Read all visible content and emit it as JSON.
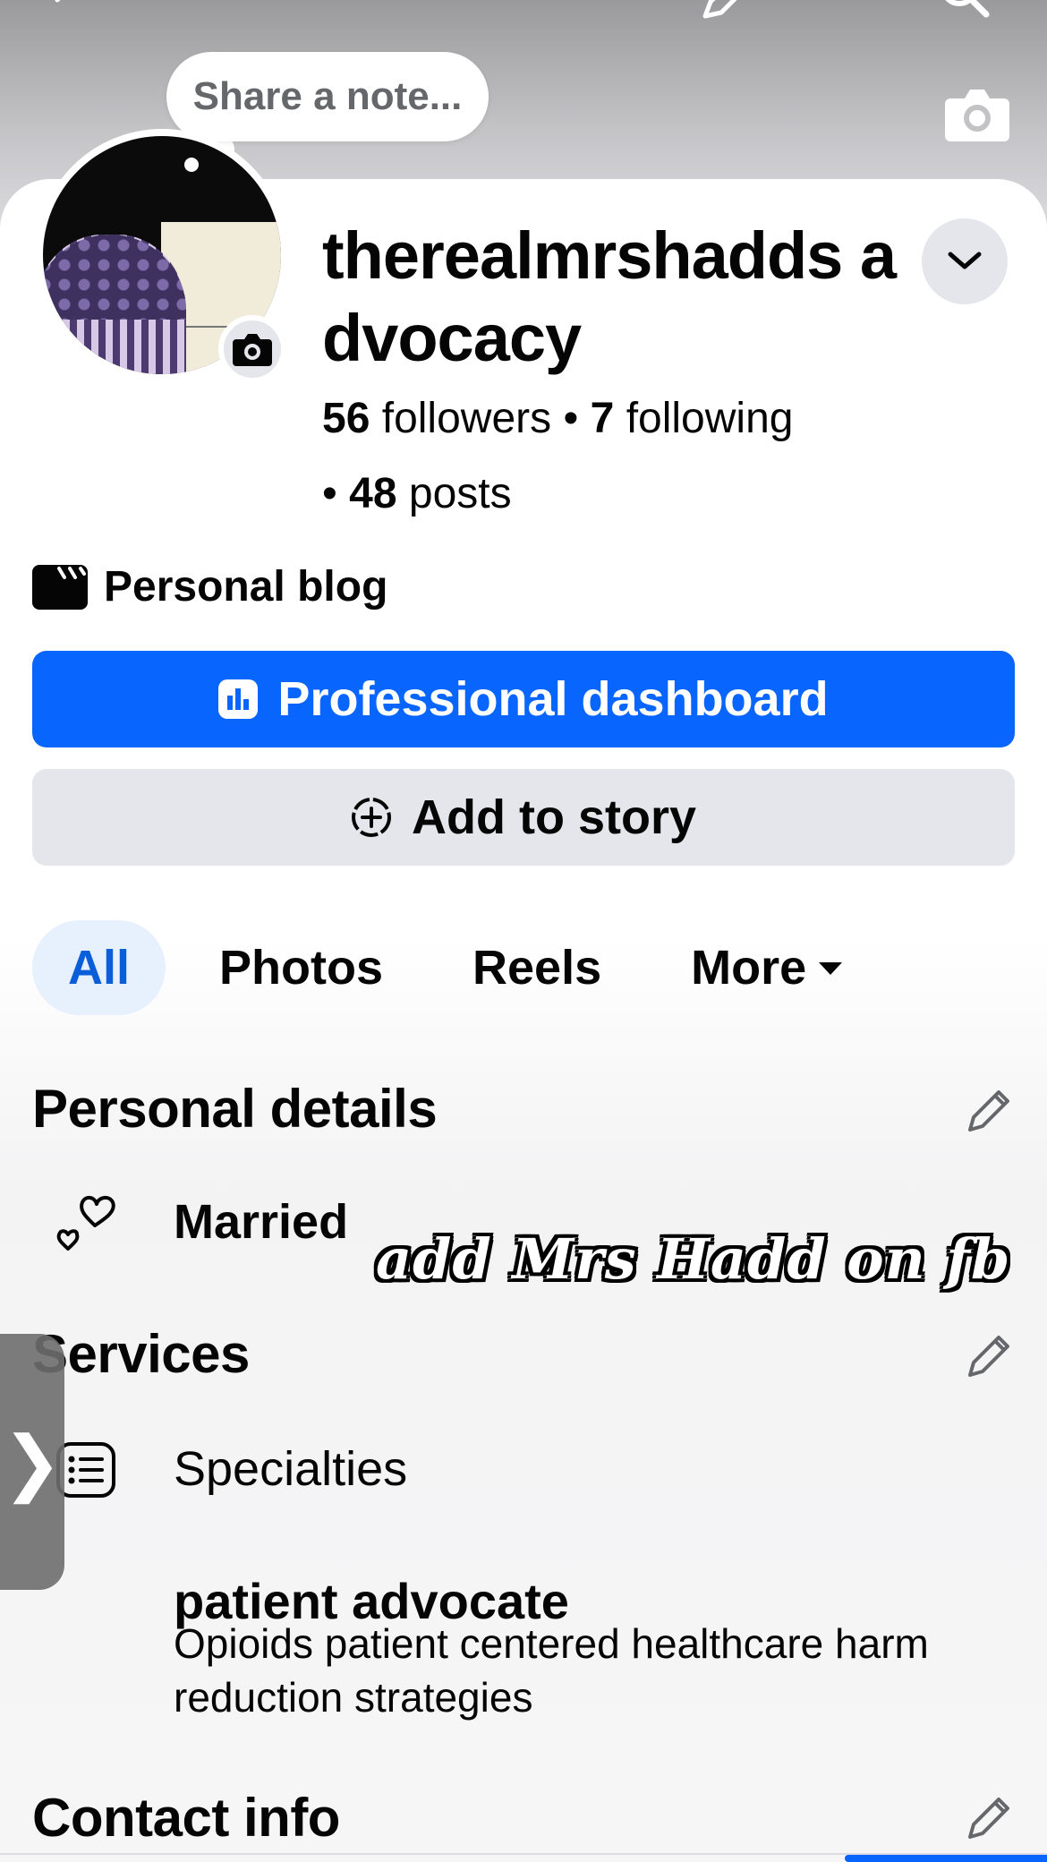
{
  "note": {
    "placeholder": "Share a note..."
  },
  "profile": {
    "name": "therealmrshadds advocacy",
    "followers_count": "56",
    "followers_label": "followers",
    "following_count": "7",
    "following_label": "following",
    "posts_count": "48",
    "posts_label": "posts",
    "separator": "•",
    "category": "Personal blog"
  },
  "buttons": {
    "dashboard": "Professional dashboard",
    "add_story": "Add to story"
  },
  "tabs": [
    {
      "label": "All",
      "active": true
    },
    {
      "label": "Photos",
      "active": false
    },
    {
      "label": "Reels",
      "active": false
    },
    {
      "label": "More",
      "active": false
    }
  ],
  "personal_details": {
    "title": "Personal details",
    "relationship": "Married"
  },
  "services": {
    "title": "Services",
    "specialties_label": "Specialties",
    "specialty_title": "patient advocate",
    "specialty_description": "Opioids patient centered healthcare harm reduction strategies"
  },
  "contact": {
    "title": "Contact info"
  },
  "overlay": {
    "caption": "add Mrs Hadd on fb"
  },
  "side_tab": {
    "glyph": "❯"
  },
  "colors": {
    "primary": "#0866ff",
    "secondary_bg": "#e4e6eb",
    "active_tab_bg": "#e7f0fd",
    "active_tab_text": "#0a5fd8"
  },
  "icons": {
    "back": "back-arrow-icon",
    "edit_top": "pencil-icon",
    "search": "search-icon",
    "cover_camera": "camera-icon",
    "avatar_camera": "camera-icon",
    "dropdown": "chevron-down-icon",
    "category": "clapperboard-icon",
    "dashboard": "bar-chart-icon",
    "add_story": "add-circle-icon",
    "more_caret": "caret-down-icon",
    "relationship": "hearts-icon",
    "specialties": "list-icon",
    "edit": "pencil-icon"
  }
}
